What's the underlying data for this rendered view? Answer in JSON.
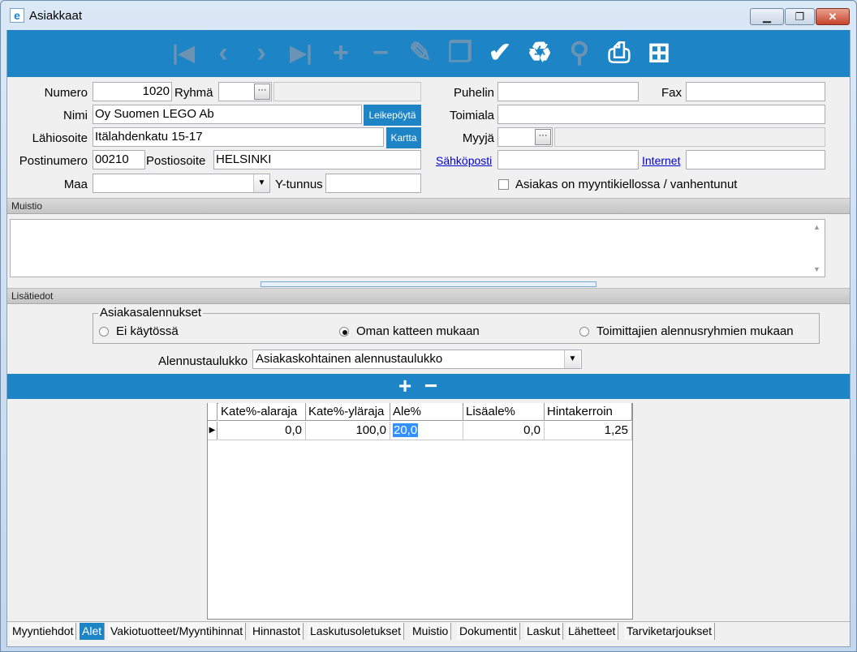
{
  "window": {
    "title": "Asiakkaat",
    "app_icon": "e",
    "controls": {
      "minimize": "▁",
      "maximize": "❐",
      "close": "✕"
    }
  },
  "toolbar": {
    "buttons": [
      {
        "name": "first-record-icon",
        "glyph": "|◀",
        "enabled": false
      },
      {
        "name": "previous-record-icon",
        "glyph": "‹",
        "enabled": false
      },
      {
        "name": "next-record-icon",
        "glyph": "›",
        "enabled": false
      },
      {
        "name": "last-record-icon",
        "glyph": "▶|",
        "enabled": false
      },
      {
        "name": "add-record-icon",
        "glyph": "+",
        "enabled": false
      },
      {
        "name": "delete-record-icon",
        "glyph": "−",
        "enabled": false
      },
      {
        "name": "edit-pencil-icon",
        "glyph": "✎",
        "enabled": false
      },
      {
        "name": "copy-record-icon",
        "glyph": "❐",
        "enabled": false
      },
      {
        "name": "save-checkmark-icon",
        "glyph": "✔",
        "enabled": true
      },
      {
        "name": "recycle-bin-icon",
        "glyph": "♻",
        "enabled": true
      },
      {
        "name": "flashlight-icon",
        "glyph": "⚲",
        "enabled": false
      },
      {
        "name": "print-icon",
        "glyph": "⎙",
        "enabled": true
      },
      {
        "name": "excel-export-icon",
        "glyph": "⊞",
        "enabled": true
      }
    ]
  },
  "form": {
    "numero_label": "Numero",
    "numero_value": "1020",
    "ryhma_label": "Ryhmä",
    "ryhma_value": "",
    "ryhma_desc": "",
    "nimi_label": "Nimi",
    "nimi_value": "Oy Suomen LEGO Ab",
    "leikepoyta_button": "Leikepöytä",
    "lahiosoite_label": "Lähiosoite",
    "lahiosoite_value": "Itälahdenkatu 15-17",
    "kartta_button": "Kartta",
    "postinumero_label": "Postinumero",
    "postinumero_value": "00210",
    "postiosoite_label": "Postiosoite",
    "postiosoite_value": "HELSINKI",
    "maa_label": "Maa",
    "maa_value": "",
    "ytunnus_label": "Y-tunnus",
    "ytunnus_value": "",
    "puhelin_label": "Puhelin",
    "puhelin_value": "",
    "fax_label": "Fax",
    "fax_value": "",
    "toimiala_label": "Toimiala",
    "toimiala_value": "",
    "myyja_label": "Myyjä",
    "myyja_value": "",
    "myyja_desc": "",
    "sahkoposti_link": "Sähköposti",
    "sahkoposti_value": "",
    "internet_link": "Internet",
    "internet_value": "",
    "myyntikielto_label": "Asiakas on myyntikiellossa / vanhentunut",
    "myyntikielto_checked": false
  },
  "muistio": {
    "header": "Muistio",
    "text": ""
  },
  "lisatiedot": {
    "header": "Lisätiedot",
    "group_title": "Asiakasalennukset",
    "options": [
      {
        "label": "Ei käytössä",
        "selected": false
      },
      {
        "label": "Oman katteen mukaan",
        "selected": true
      },
      {
        "label": "Toimittajien alennusryhmien mukaan",
        "selected": false
      }
    ],
    "alennustaulukko_label": "Alennustaulukko",
    "alennustaulukko_value": "Asiakaskohtainen alennustaulukko"
  },
  "grid_toolbar": {
    "add": "+",
    "remove": "−"
  },
  "grid": {
    "columns": [
      "Kate%-alaraja",
      "Kate%-yläraja",
      "Ale%",
      "Lisäale%",
      "Hintakerroin"
    ],
    "rows": [
      [
        "0,0",
        "100,0",
        "20,0",
        "0,0",
        "1,25"
      ]
    ],
    "selected_cell": {
      "row": 0,
      "col": 2
    }
  },
  "tabs": [
    {
      "label": "Myyntiehdot",
      "active": false
    },
    {
      "label": "Alet",
      "active": true
    },
    {
      "label": "Vakiotuotteet/Myyntihinnat",
      "active": false
    },
    {
      "label": "Hinnastot",
      "active": false
    },
    {
      "label": "Laskutusoletukset",
      "active": false
    },
    {
      "label": "Muistio",
      "active": false
    },
    {
      "label": "Dokumentit",
      "active": false
    },
    {
      "label": "Laskut",
      "active": false
    },
    {
      "label": "Lähetteet",
      "active": false
    },
    {
      "label": "Tarviketarjoukset",
      "active": false
    }
  ]
}
